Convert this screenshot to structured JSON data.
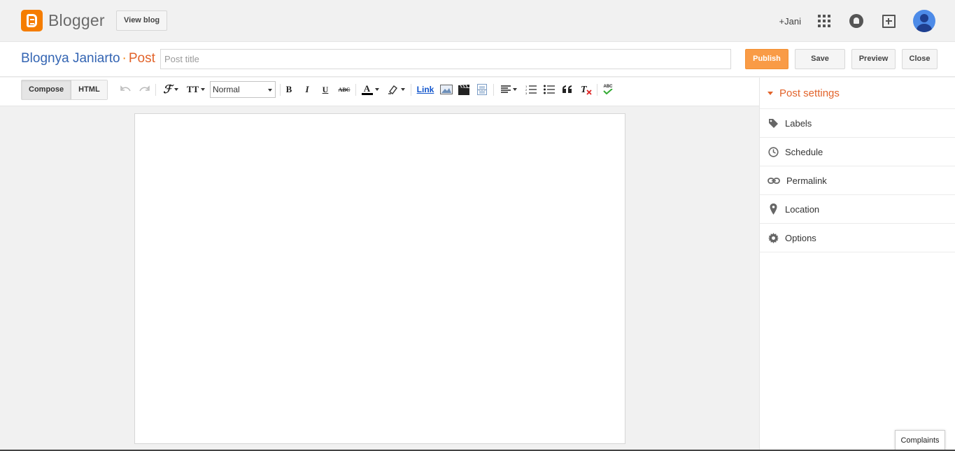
{
  "header": {
    "logo_text": "Blogger",
    "view_blog": "View blog",
    "user_name": "+Jani"
  },
  "post": {
    "blog_name": "Blognya Janiarto",
    "separator": "·",
    "post_word": "Post",
    "title_value": "",
    "title_placeholder": "Post title",
    "publish": "Publish",
    "save": "Save",
    "preview": "Preview",
    "close": "Close"
  },
  "toolbar": {
    "compose": "Compose",
    "html": "HTML",
    "format_value": "Normal",
    "bold": "B",
    "italic": "I",
    "underline": "U",
    "strike": "ABC",
    "text_color": "A",
    "link": "Link",
    "spellcheck": "ABC"
  },
  "sidebar": {
    "heading": "Post settings",
    "items": [
      {
        "label": "Labels",
        "icon": "tag-icon"
      },
      {
        "label": "Schedule",
        "icon": "clock-icon"
      },
      {
        "label": "Permalink",
        "icon": "link-icon"
      },
      {
        "label": "Location",
        "icon": "pin-icon"
      },
      {
        "label": "Options",
        "icon": "gear-icon"
      }
    ]
  },
  "footer": {
    "complaints": "Complaints"
  },
  "colors": {
    "brand_orange": "#f57d00",
    "publish_bg": "#f99b46",
    "blog_name_blue": "#3465b3",
    "accent_orange_text": "#e2632a"
  }
}
